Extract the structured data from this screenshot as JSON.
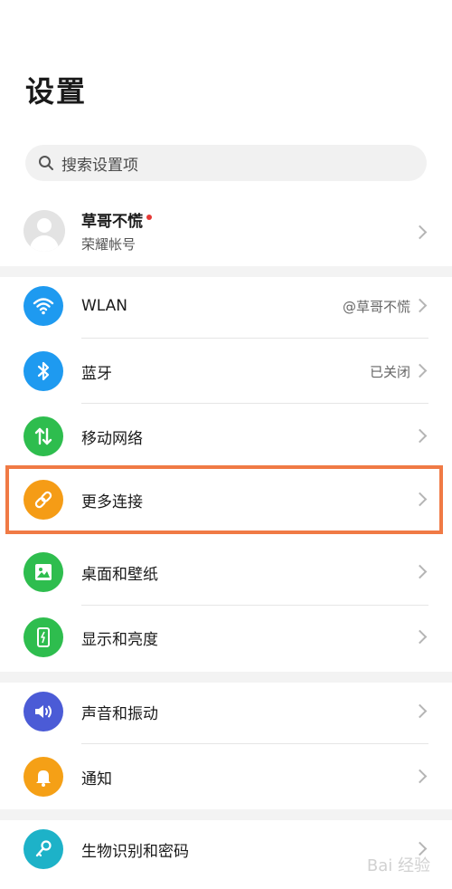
{
  "header": {
    "title": "设置"
  },
  "search": {
    "placeholder": "搜索设置项"
  },
  "account": {
    "name": "草哥不慌",
    "subtitle": "荣耀帐号"
  },
  "items": [
    {
      "label": "WLAN",
      "value": "@草哥不慌",
      "icon": "wifi-icon",
      "color": "#1e9af0"
    },
    {
      "label": "蓝牙",
      "value": "已关闭",
      "icon": "bluetooth-icon",
      "color": "#1e9af0"
    },
    {
      "label": "移动网络",
      "value": "",
      "icon": "mobile-data-icon",
      "color": "#2ebd4e"
    },
    {
      "label": "更多连接",
      "value": "",
      "icon": "link-icon",
      "color": "#f59c16"
    },
    {
      "label": "桌面和壁纸",
      "value": "",
      "icon": "wallpaper-icon",
      "color": "#2ebd4e"
    },
    {
      "label": "显示和亮度",
      "value": "",
      "icon": "display-icon",
      "color": "#2ebd4e"
    },
    {
      "label": "声音和振动",
      "value": "",
      "icon": "sound-icon",
      "color": "#4b5bd6"
    },
    {
      "label": "通知",
      "value": "",
      "icon": "bell-icon",
      "color": "#f5a016"
    },
    {
      "label": "生物识别和密码",
      "value": "",
      "icon": "key-icon",
      "color": "#1db2c8"
    }
  ],
  "watermark": "Bai 经验"
}
